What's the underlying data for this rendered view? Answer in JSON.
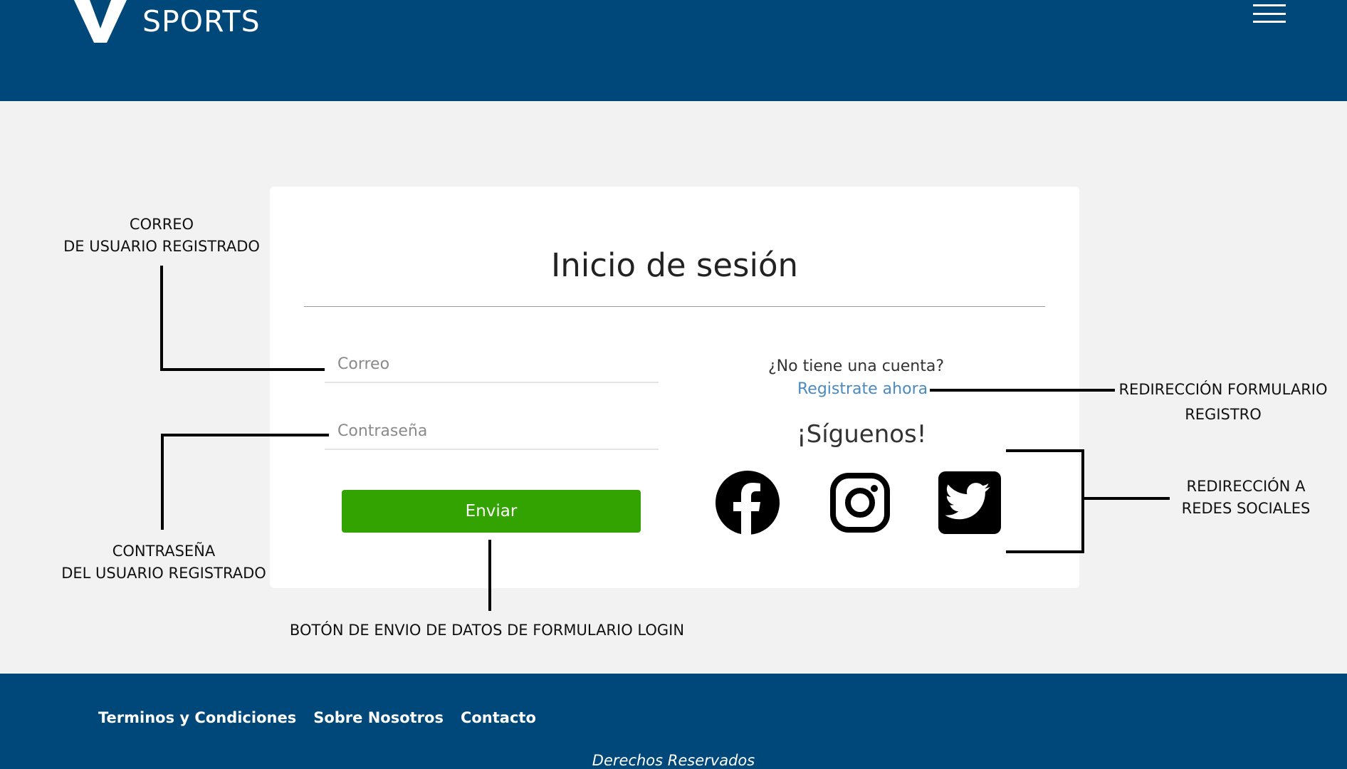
{
  "header": {
    "logo_text": "SPORTS",
    "menu_icon": "hamburger-menu-icon"
  },
  "login": {
    "title": "Inicio de sesión",
    "email_placeholder": "Correo",
    "password_placeholder": "Contraseña",
    "submit_label": "Enviar",
    "no_account_text": "¿No tiene una cuenta?",
    "register_link": "Registrate ahora",
    "follow_title": "¡Síguenos!",
    "social_icons": [
      "facebook-icon",
      "instagram-icon",
      "twitter-icon"
    ]
  },
  "annotations": {
    "email_line1": "CORREO",
    "email_line2": "DE USUARIO REGISTRADO",
    "password_line1": "CONTRASEÑA",
    "password_line2": "DEL USUARIO REGISTRADO",
    "submit": "BOTÓN DE ENVIO DE DATOS DE FORMULARIO LOGIN",
    "register_line1": "REDIRECCIÓN FORMULARIO",
    "register_line2": "REGISTRO",
    "social_line1": "REDIRECCIÓN A",
    "social_line2": "REDES SOCIALES"
  },
  "footer": {
    "links": [
      "Terminos y Condiciones",
      "Sobre Nosotros",
      "Contacto"
    ],
    "rights": "Derechos Reservados"
  },
  "colors": {
    "brand_blue": "#00477a",
    "submit_green": "#32a300",
    "link_blue": "#4a8ac0"
  }
}
